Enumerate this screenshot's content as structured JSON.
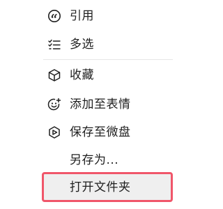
{
  "context_menu": {
    "items": [
      {
        "id": "quote",
        "label": "引用",
        "icon": "quote-icon"
      },
      {
        "id": "multi-select",
        "label": "多选",
        "icon": "checklist-icon"
      },
      {
        "id": "favorite",
        "label": "收藏",
        "icon": "cube-icon"
      },
      {
        "id": "add-sticker",
        "label": "添加至表情",
        "icon": "smile-add-icon"
      },
      {
        "id": "save-to-weiyun",
        "label": "保存至微盘",
        "icon": "cloud-drive-icon"
      },
      {
        "id": "save-as",
        "label": "另存为..."
      },
      {
        "id": "open-folder",
        "label": "打开文件夹",
        "highlighted": true
      }
    ]
  },
  "highlight_color": "#f0566a",
  "hover_background": "#efefef"
}
